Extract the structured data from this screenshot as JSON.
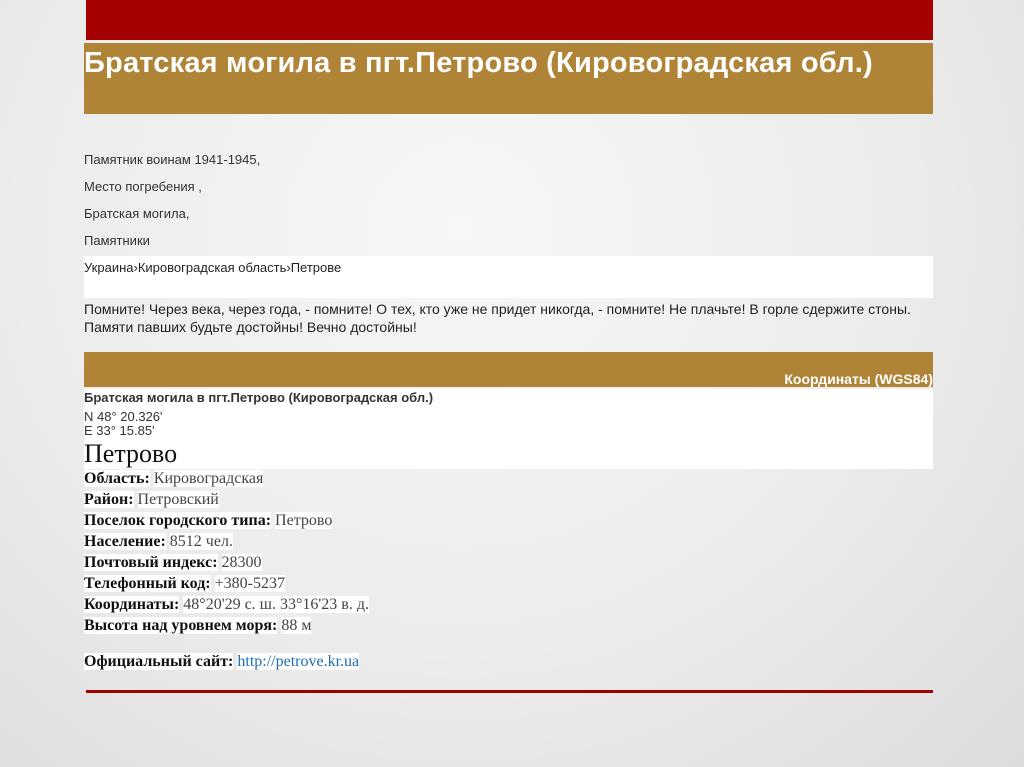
{
  "title": "Братская могила в пгт.Петрово (Кировоградская обл.)",
  "tags": [
    "Памятник воинам 1941-1945,",
    "Место погребения ,",
    "Братская могила,",
    "Памятники"
  ],
  "breadcrumb": "Украина›Кировоградская область›Петрове",
  "quote": "Помните! Через века, через года, - помните! О тех, кто уже не придет никогда, - помните! Не плачьте! В горле сдержите стоны. Памяти павших будьте достойны! Вечно достойны!",
  "coords_header": "Координаты (WGS84)",
  "memorial_title": "Братская могила в пгт.Петрово (Кировоградская обл.)",
  "coord_n": "N 48° 20.326'",
  "coord_e": "E 33° 15.85'",
  "town_heading": "Петрово",
  "info": [
    {
      "label": "Область:",
      "value": "Кировоградская"
    },
    {
      "label": "Район:",
      "value": "Петровский"
    },
    {
      "label": "Поселок городского типа:",
      "value": "Петрово"
    },
    {
      "label": "Население:",
      "value": "8512 чел."
    },
    {
      "label": "Почтовый индекс:",
      "value": "28300"
    },
    {
      "label": "Телефонный код:",
      "value": "+380-5237"
    },
    {
      "label": "Координаты:",
      "value": "48°20'29 с. ш. 33°16'23 в. д."
    },
    {
      "label": "Высота над уровнем моря:",
      "value": "88 м"
    }
  ],
  "site": {
    "label": "Официальный сайт:",
    "value": "http://petrove.kr.ua"
  },
  "colors": {
    "accent_red": "#a50000",
    "band_gold": "#b08436",
    "link_blue": "#1a6db3"
  }
}
